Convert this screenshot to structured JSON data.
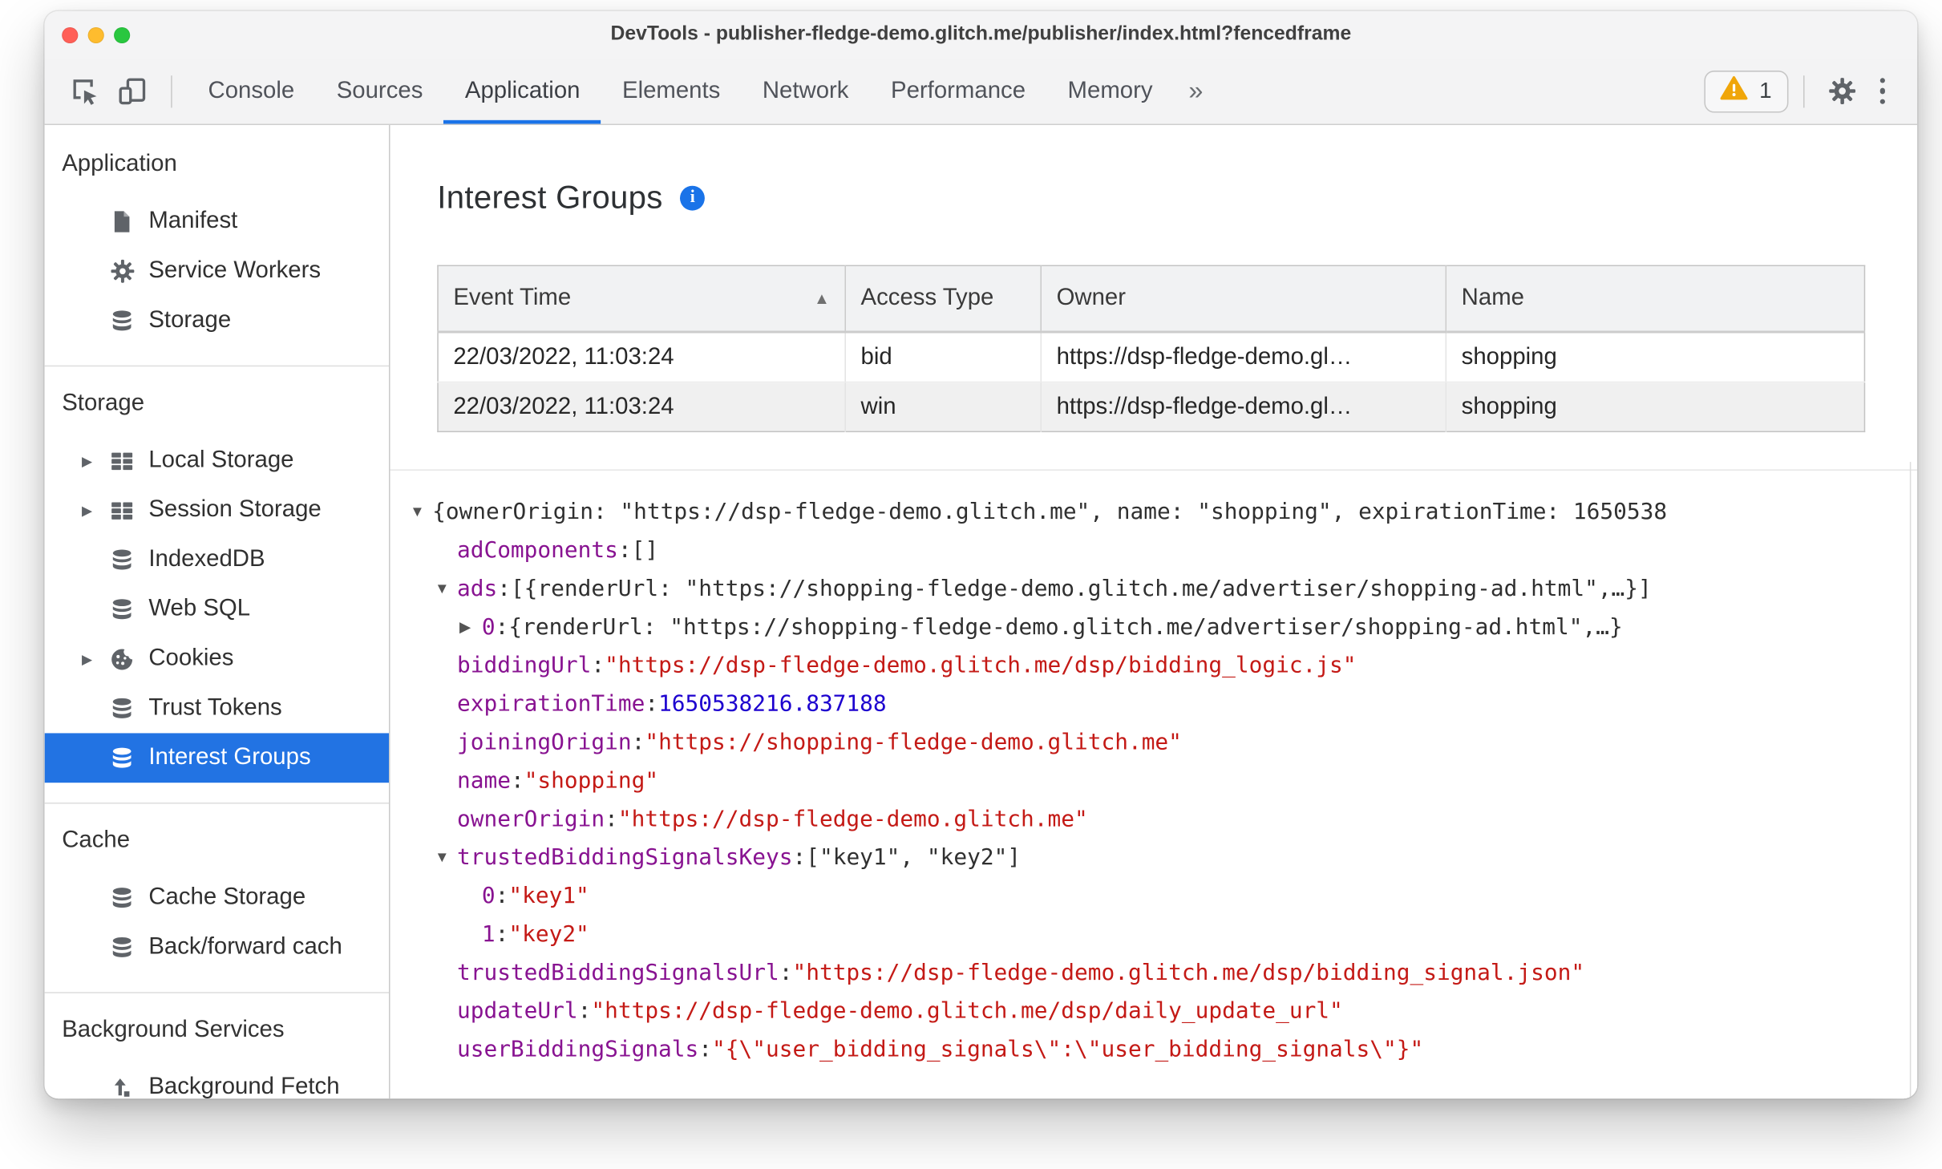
{
  "colors": {
    "accent": "#1a73e8",
    "selection": "#2273e3",
    "warning": "#f0a60a",
    "json-key": "#881391",
    "json-string": "#c41a16",
    "json-number": "#1c00cf",
    "traffic-red": "#ff5f57",
    "traffic-yellow": "#febc2e",
    "traffic-green": "#29c73f"
  },
  "window": {
    "title": "DevTools - publisher-fledge-demo.glitch.me/publisher/index.html?fencedframe"
  },
  "toolbar": {
    "tabs": [
      {
        "label": "Console"
      },
      {
        "label": "Sources"
      },
      {
        "label": "Application",
        "active": true
      },
      {
        "label": "Elements"
      },
      {
        "label": "Network"
      },
      {
        "label": "Performance"
      },
      {
        "label": "Memory"
      }
    ],
    "more_tabs_label": "»",
    "issues": {
      "count": "1"
    }
  },
  "sidebar": {
    "sections": [
      {
        "title": "Application",
        "items": [
          {
            "label": "Manifest",
            "icon": "document-icon"
          },
          {
            "label": "Service Workers",
            "icon": "gear-icon"
          },
          {
            "label": "Storage",
            "icon": "database-icon"
          }
        ]
      },
      {
        "title": "Storage",
        "items": [
          {
            "label": "Local Storage",
            "icon": "table-icon",
            "expandable": true
          },
          {
            "label": "Session Storage",
            "icon": "table-icon",
            "expandable": true
          },
          {
            "label": "IndexedDB",
            "icon": "database-icon"
          },
          {
            "label": "Web SQL",
            "icon": "database-icon"
          },
          {
            "label": "Cookies",
            "icon": "cookie-icon",
            "expandable": true
          },
          {
            "label": "Trust Tokens",
            "icon": "database-icon"
          },
          {
            "label": "Interest Groups",
            "icon": "database-icon",
            "selected": true
          }
        ]
      },
      {
        "title": "Cache",
        "items": [
          {
            "label": "Cache Storage",
            "icon": "database-icon"
          },
          {
            "label": "Back/forward cach",
            "icon": "database-icon"
          }
        ]
      },
      {
        "title": "Background Services",
        "items": [
          {
            "label": "Background Fetch",
            "icon": "background-fetch-icon"
          }
        ]
      }
    ]
  },
  "main": {
    "heading": "Interest Groups",
    "table": {
      "columns": [
        {
          "label": "Event Time",
          "sort": "asc"
        },
        {
          "label": "Access Type"
        },
        {
          "label": "Owner"
        },
        {
          "label": "Name"
        }
      ],
      "rows": [
        [
          "22/03/2022, 11:03:24",
          "bid",
          "https://dsp-fledge-demo.gl…",
          "shopping"
        ],
        [
          "22/03/2022, 11:03:24",
          "win",
          "https://dsp-fledge-demo.gl…",
          "shopping"
        ]
      ]
    },
    "tree": {
      "lines": [
        {
          "level": 0,
          "arrow": "down",
          "segments": [
            {
              "t": "{ownerOrigin: \"https://dsp-fledge-demo.glitch.me\", name: \"shopping\", expirationTime: 1650538",
              "c": "plain"
            }
          ]
        },
        {
          "level": 1,
          "arrow": null,
          "segments": [
            {
              "t": "adComponents",
              "c": "key"
            },
            {
              "t": ": ",
              "c": "plain"
            },
            {
              "t": "[]",
              "c": "plain"
            }
          ]
        },
        {
          "level": 1,
          "arrow": "down",
          "segments": [
            {
              "t": "ads",
              "c": "key"
            },
            {
              "t": ": ",
              "c": "plain"
            },
            {
              "t": "[{renderUrl: \"https://shopping-fledge-demo.glitch.me/advertiser/shopping-ad.html\",…}]",
              "c": "plain"
            }
          ]
        },
        {
          "level": 2,
          "arrow": "right",
          "segments": [
            {
              "t": "0",
              "c": "key"
            },
            {
              "t": ": ",
              "c": "plain"
            },
            {
              "t": "{renderUrl: \"https://shopping-fledge-demo.glitch.me/advertiser/shopping-ad.html\",…}",
              "c": "plain"
            }
          ]
        },
        {
          "level": 1,
          "arrow": null,
          "segments": [
            {
              "t": "biddingUrl",
              "c": "key"
            },
            {
              "t": ": ",
              "c": "plain"
            },
            {
              "t": "\"https://dsp-fledge-demo.glitch.me/dsp/bidding_logic.js\"",
              "c": "str"
            }
          ]
        },
        {
          "level": 1,
          "arrow": null,
          "segments": [
            {
              "t": "expirationTime",
              "c": "key"
            },
            {
              "t": ": ",
              "c": "plain"
            },
            {
              "t": "1650538216.837188",
              "c": "num"
            }
          ]
        },
        {
          "level": 1,
          "arrow": null,
          "segments": [
            {
              "t": "joiningOrigin",
              "c": "key"
            },
            {
              "t": ": ",
              "c": "plain"
            },
            {
              "t": "\"https://shopping-fledge-demo.glitch.me\"",
              "c": "str"
            }
          ]
        },
        {
          "level": 1,
          "arrow": null,
          "segments": [
            {
              "t": "name",
              "c": "key"
            },
            {
              "t": ": ",
              "c": "plain"
            },
            {
              "t": "\"shopping\"",
              "c": "str"
            }
          ]
        },
        {
          "level": 1,
          "arrow": null,
          "segments": [
            {
              "t": "ownerOrigin",
              "c": "key"
            },
            {
              "t": ": ",
              "c": "plain"
            },
            {
              "t": "\"https://dsp-fledge-demo.glitch.me\"",
              "c": "str"
            }
          ]
        },
        {
          "level": 1,
          "arrow": "down",
          "segments": [
            {
              "t": "trustedBiddingSignalsKeys",
              "c": "key"
            },
            {
              "t": ": ",
              "c": "plain"
            },
            {
              "t": "[\"key1\", \"key2\"]",
              "c": "plain"
            }
          ]
        },
        {
          "level": 2,
          "arrow": null,
          "segments": [
            {
              "t": "0",
              "c": "key"
            },
            {
              "t": ": ",
              "c": "plain"
            },
            {
              "t": "\"key1\"",
              "c": "str"
            }
          ]
        },
        {
          "level": 2,
          "arrow": null,
          "segments": [
            {
              "t": "1",
              "c": "key"
            },
            {
              "t": ": ",
              "c": "plain"
            },
            {
              "t": "\"key2\"",
              "c": "str"
            }
          ]
        },
        {
          "level": 1,
          "arrow": null,
          "segments": [
            {
              "t": "trustedBiddingSignalsUrl",
              "c": "key"
            },
            {
              "t": ": ",
              "c": "plain"
            },
            {
              "t": "\"https://dsp-fledge-demo.glitch.me/dsp/bidding_signal.json\"",
              "c": "str"
            }
          ]
        },
        {
          "level": 1,
          "arrow": null,
          "segments": [
            {
              "t": "updateUrl",
              "c": "key"
            },
            {
              "t": ": ",
              "c": "plain"
            },
            {
              "t": "\"https://dsp-fledge-demo.glitch.me/dsp/daily_update_url\"",
              "c": "str"
            }
          ]
        },
        {
          "level": 1,
          "arrow": null,
          "segments": [
            {
              "t": "userBiddingSignals",
              "c": "key"
            },
            {
              "t": ": ",
              "c": "plain"
            },
            {
              "t": "\"{\\\"user_bidding_signals\\\":\\\"user_bidding_signals\\\"}\"",
              "c": "str"
            }
          ]
        }
      ]
    }
  }
}
